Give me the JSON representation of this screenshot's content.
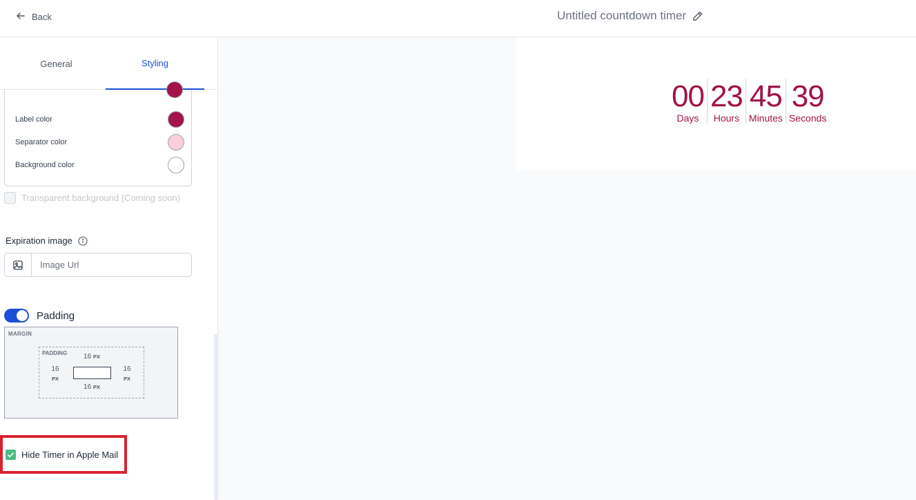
{
  "header": {
    "back_label": "Back",
    "title": "Untitled countdown timer"
  },
  "tabs": [
    {
      "label": "General",
      "active": false
    },
    {
      "label": "Styling",
      "active": true
    }
  ],
  "colors": [
    {
      "label": "Label color",
      "value": "#a1134a"
    },
    {
      "label": "Separator color",
      "value": "#fbcfd9"
    },
    {
      "label": "Background color",
      "value": "#ffffff"
    }
  ],
  "transparent_background": {
    "label": "Transparent background (Coming soon)",
    "checked": false
  },
  "expiration_image": {
    "label": "Expiration image",
    "placeholder": "Image Url",
    "value": ""
  },
  "padding": {
    "label": "Padding",
    "enabled": true,
    "margin_label": "MARGIN",
    "padding_label": "PADDING",
    "top": "16",
    "bottom": "16",
    "left": "16",
    "right": "16",
    "unit": "PX"
  },
  "hide_apple_mail": {
    "label": "Hide Timer in Apple Mail",
    "checked": true
  },
  "timer": {
    "units": [
      {
        "value": "00",
        "label": "Days"
      },
      {
        "value": "23",
        "label": "Hours"
      },
      {
        "value": "45",
        "label": "Minutes"
      },
      {
        "value": "39",
        "label": "Seconds"
      }
    ],
    "color": "#a1134a"
  }
}
